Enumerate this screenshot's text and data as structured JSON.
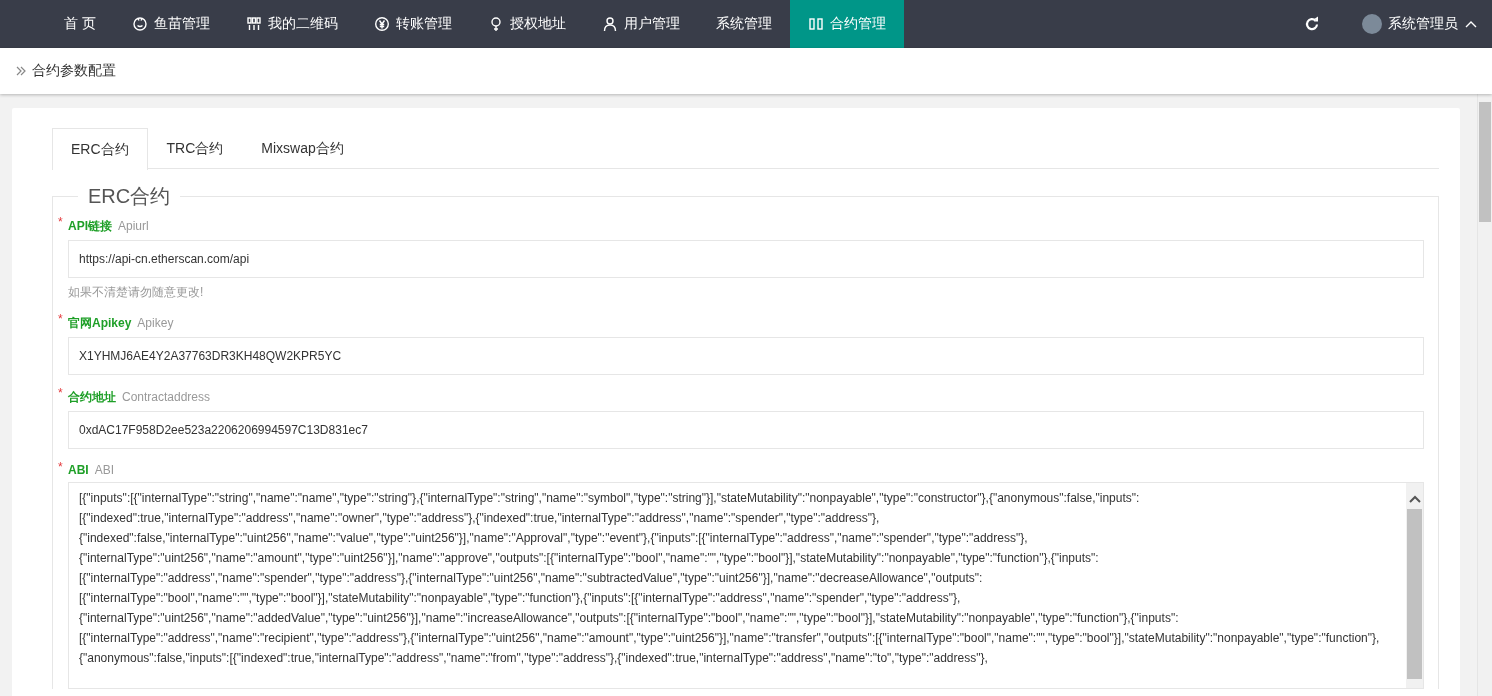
{
  "nav": {
    "items": [
      {
        "label": "首 页",
        "selected": false
      },
      {
        "label": "鱼苗管理",
        "selected": false
      },
      {
        "label": "我的二维码",
        "selected": false
      },
      {
        "label": "转账管理",
        "selected": false
      },
      {
        "label": "授权地址",
        "selected": false
      },
      {
        "label": "用户管理",
        "selected": false
      },
      {
        "label": "系统管理",
        "selected": false
      },
      {
        "label": "合约管理",
        "selected": true
      }
    ],
    "user": "系统管理员"
  },
  "breadcrumb": "合约参数配置",
  "tabs": [
    {
      "label": "ERC合约",
      "selected": true
    },
    {
      "label": "TRC合约",
      "selected": false
    },
    {
      "label": "Mixswap合约",
      "selected": false
    }
  ],
  "fieldset": {
    "legend": "ERC合约",
    "fields": [
      {
        "label": "API链接",
        "hint": "Apiurl",
        "mark": "*",
        "value": "https://api-cn.etherscan.com/api",
        "help": "如果不清楚请勿随意更改!"
      },
      {
        "label": "官网Apikey",
        "hint": "Apikey",
        "mark": "*",
        "value": "X1YHMJ6AE4Y2A37763DR3KH48QW2KPR5YC"
      },
      {
        "label": "合约地址",
        "hint": "Contractaddress",
        "mark": "*",
        "value": "0xdAC17F958D2ee523a2206206994597C13D831ec7"
      }
    ],
    "abi": {
      "label": "ABI",
      "hint": "ABI",
      "mark": "*",
      "value": "[{\"inputs\":[{\"internalType\":\"string\",\"name\":\"name\",\"type\":\"string\"},{\"internalType\":\"string\",\"name\":\"symbol\",\"type\":\"string\"}],\"stateMutability\":\"nonpayable\",\"type\":\"constructor\"},{\"anonymous\":false,\"inputs\":[{\"indexed\":true,\"internalType\":\"address\",\"name\":\"owner\",\"type\":\"address\"},{\"indexed\":true,\"internalType\":\"address\",\"name\":\"spender\",\"type\":\"address\"},{\"indexed\":false,\"internalType\":\"uint256\",\"name\":\"value\",\"type\":\"uint256\"}],\"name\":\"Approval\",\"type\":\"event\"},{\"inputs\":[{\"internalType\":\"address\",\"name\":\"spender\",\"type\":\"address\"},{\"internalType\":\"uint256\",\"name\":\"amount\",\"type\":\"uint256\"}],\"name\":\"approve\",\"outputs\":[{\"internalType\":\"bool\",\"name\":\"\",\"type\":\"bool\"}],\"stateMutability\":\"nonpayable\",\"type\":\"function\"},{\"inputs\":[{\"internalType\":\"address\",\"name\":\"spender\",\"type\":\"address\"},{\"internalType\":\"uint256\",\"name\":\"subtractedValue\",\"type\":\"uint256\"}],\"name\":\"decreaseAllowance\",\"outputs\":[{\"internalType\":\"bool\",\"name\":\"\",\"type\":\"bool\"}],\"stateMutability\":\"nonpayable\",\"type\":\"function\"},{\"inputs\":[{\"internalType\":\"address\",\"name\":\"spender\",\"type\":\"address\"},{\"internalType\":\"uint256\",\"name\":\"addedValue\",\"type\":\"uint256\"}],\"name\":\"increaseAllowance\",\"outputs\":[{\"internalType\":\"bool\",\"name\":\"\",\"type\":\"bool\"}],\"stateMutability\":\"nonpayable\",\"type\":\"function\"},{\"inputs\":[{\"internalType\":\"address\",\"name\":\"recipient\",\"type\":\"address\"},{\"internalType\":\"uint256\",\"name\":\"amount\",\"type\":\"uint256\"}],\"name\":\"transfer\",\"outputs\":[{\"internalType\":\"bool\",\"name\":\"\",\"type\":\"bool\"}],\"stateMutability\":\"nonpayable\",\"type\":\"function\"},{\"anonymous\":false,\"inputs\":[{\"indexed\":true,\"internalType\":\"address\",\"name\":\"from\",\"type\":\"address\"},{\"indexed\":true,\"internalType\":\"address\",\"name\":\"to\",\"type\":\"address\"},"
    }
  }
}
